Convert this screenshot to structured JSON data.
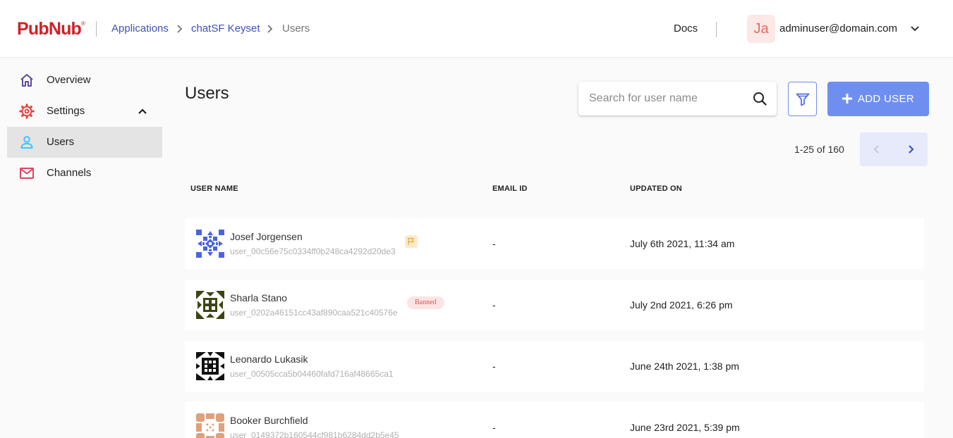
{
  "header": {
    "logo_text": "PubNub",
    "logo_mark": "®",
    "breadcrumb": [
      "Applications",
      "chatSF Keyset",
      "Users"
    ],
    "docs_label": "Docs",
    "user_initials": "Ja",
    "user_email": "adminuser@domain.com"
  },
  "sidebar": {
    "items": [
      {
        "label": "Overview",
        "icon": "home-icon"
      },
      {
        "label": "Settings",
        "icon": "gear-icon"
      },
      {
        "label": "Users",
        "icon": "user-icon"
      },
      {
        "label": "Channels",
        "icon": "mail-icon"
      }
    ]
  },
  "main": {
    "title": "Users",
    "search_placeholder": "Search for user name",
    "add_label": "ADD USER",
    "pagination": "1-25 of 160",
    "columns": [
      "USER NAME",
      "EMAIL ID",
      "UPDATED ON"
    ],
    "rows": [
      {
        "name": "Josef Jorgensen",
        "id": "user_00c56e75c0334ff0b248ca4292d20de3",
        "email": "-",
        "updated": "July 6th 2021, 11:34 am",
        "badge": "flag"
      },
      {
        "name": "Sharla Stano",
        "id": "user_0202a46151cc43af890caa521c40576e",
        "email": "-",
        "updated": "July 2nd 2021, 6:26 pm",
        "badge": "Banned"
      },
      {
        "name": "Leonardo Lukasik",
        "id": "user_00505cca5b04460fafd716af48665ca1",
        "email": "-",
        "updated": "June 24th 2021, 1:38 pm",
        "badge": ""
      },
      {
        "name": "Booker Burchfield",
        "id": "user_0149372b160544cf981b6284dd2b5e45",
        "email": "-",
        "updated": "June 23rd 2021, 5:39 pm",
        "badge": ""
      }
    ]
  },
  "colors": {
    "brand": "#d02129",
    "link": "#3f51b5",
    "accent": "#6f8ff0",
    "avatar_1": "#4a63e0",
    "avatar_2": "#3d4514",
    "avatar_3": "#111111",
    "avatar_4": "#e0a07a"
  }
}
